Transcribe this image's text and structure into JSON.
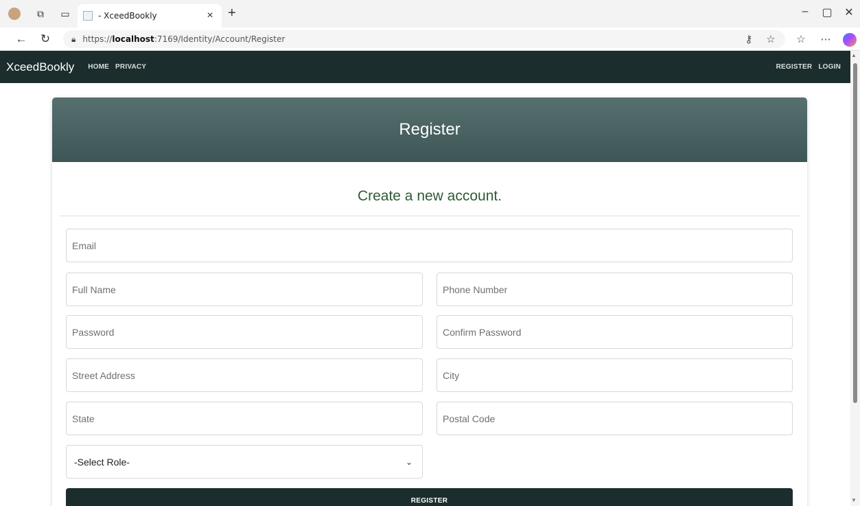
{
  "browser": {
    "tab_title": "- XceedBookly",
    "tab_close": "×",
    "new_tab": "+",
    "url_prefix": "https://",
    "url_host": "localhost",
    "url_rest": ":7169/Identity/Account/Register",
    "icons": [
      "profile-avatar",
      "workspaces-icon",
      "tab-actions-icon",
      "back-arrow-icon",
      "refresh-icon",
      "lock-icon",
      "key-icon",
      "star-icon",
      "favorites-icon",
      "more-icon",
      "copilot-icon",
      "minimize-icon",
      "restore-icon",
      "close-window-icon"
    ]
  },
  "navbar": {
    "brand": "XceedBookly",
    "links": [
      "HOME",
      "PRIVACY"
    ],
    "right_links": [
      "REGISTER",
      "LOGIN"
    ],
    "background": "#1b2d2d"
  },
  "card": {
    "header_title": "Register",
    "subtitle": "Create a new account.",
    "subtitle_color": "#2f5a35"
  },
  "form": {
    "email_placeholder": "Email",
    "fullname_placeholder": "Full Name",
    "phone_placeholder": "Phone Number",
    "password_placeholder": "Password",
    "confirm_password_placeholder": "Confirm Password",
    "street_placeholder": "Street Address",
    "city_placeholder": "City",
    "state_placeholder": "State",
    "postal_placeholder": "Postal Code",
    "role_selected": "-Select Role-",
    "submit_label": "REGISTER"
  }
}
